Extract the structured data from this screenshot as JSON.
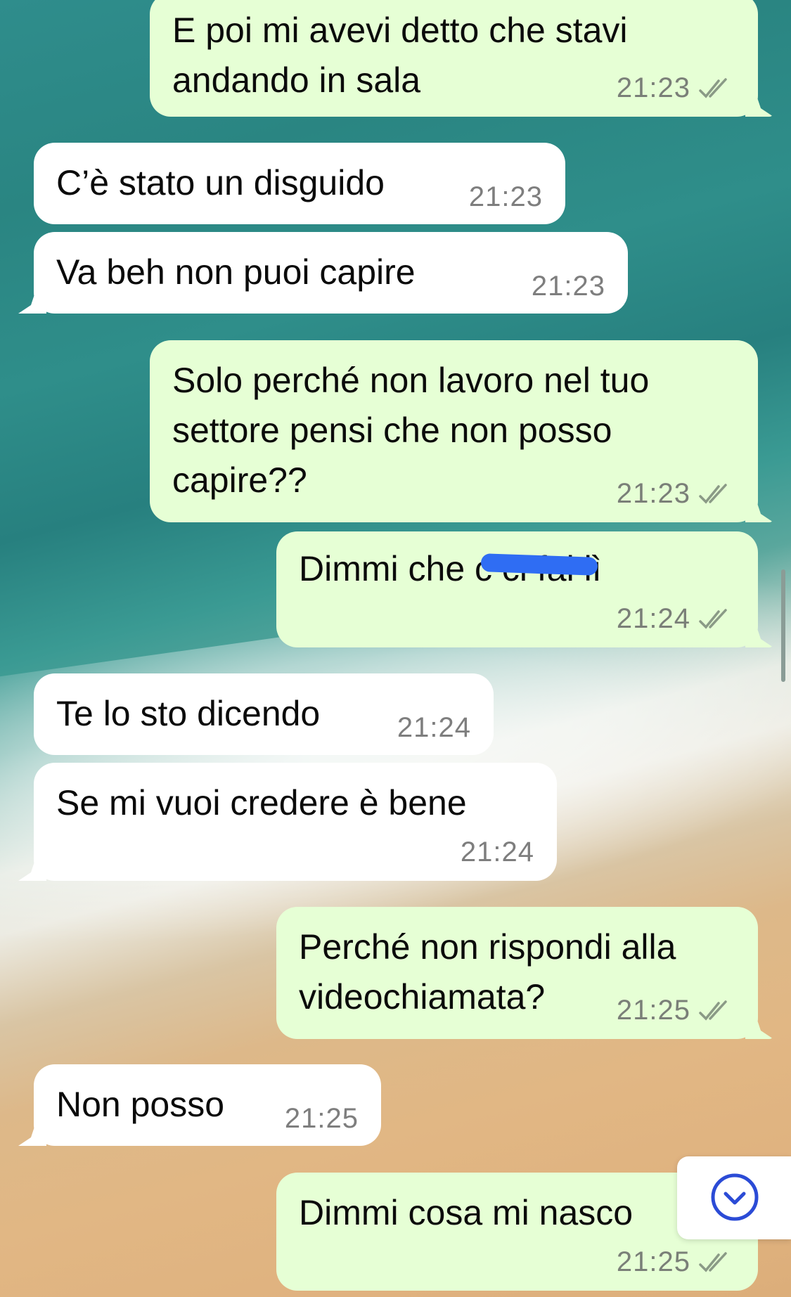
{
  "messages": [
    {
      "text": "E poi mi avevi detto che stavi\nandando in sala",
      "time": "21:23",
      "direction": "outgoing",
      "status": "read"
    },
    {
      "text": "C’è stato un disguido",
      "time": "21:23",
      "direction": "incoming"
    },
    {
      "text": "Va beh non puoi capire",
      "time": "21:23",
      "direction": "incoming"
    },
    {
      "text": "Solo perché non lavoro nel tuo\nsettore pensi che non posso\ncapire??",
      "time": "21:23",
      "direction": "outgoing",
      "status": "read"
    },
    {
      "text": "Dimmi che c       ci fai lì",
      "time": "21:24",
      "direction": "outgoing",
      "status": "read"
    },
    {
      "text": "Te lo sto dicendo",
      "time": "21:24",
      "direction": "incoming"
    },
    {
      "text": "Se mi vuoi credere è bene",
      "time": "21:24",
      "direction": "incoming"
    },
    {
      "text": "Perché non rispondi alla\nvideochiamata?",
      "time": "21:25",
      "direction": "outgoing",
      "status": "read"
    },
    {
      "text": "Non posso",
      "time": "21:25",
      "direction": "incoming"
    },
    {
      "text": "Dimmi cosa mi nasco",
      "time": "21:25",
      "direction": "outgoing",
      "status": "read"
    }
  ],
  "icons": {
    "ticks": "double-check-icon",
    "scroll_down": "chevron-down-circle-icon"
  },
  "colors": {
    "outgoing_bubble": "#e6ffd5",
    "incoming_bubble": "#ffffff",
    "tick": "#8a9a86",
    "scroll_button_icon": "#2b4bd6",
    "redaction": "#2f6df3"
  }
}
